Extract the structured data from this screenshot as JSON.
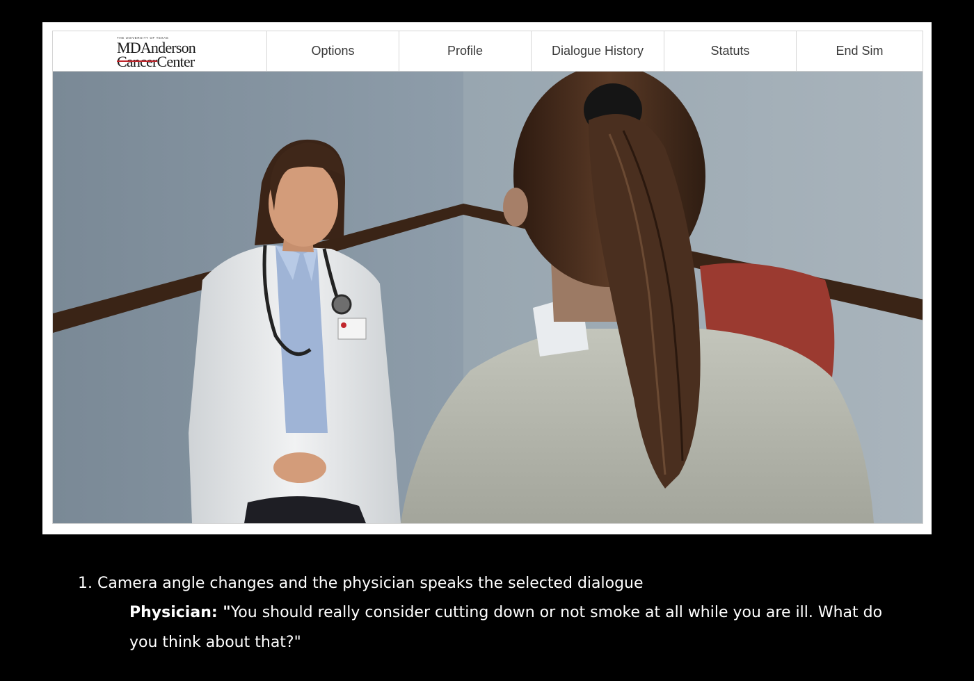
{
  "navbar": {
    "logo": {
      "small_text": "THE UNIVERSITY OF TEXAS",
      "line1": "MDAnderson",
      "line2_struck": "Cancer",
      "line2_rest": "Center"
    },
    "items": [
      {
        "label": "Options"
      },
      {
        "label": "Profile"
      },
      {
        "label": "Dialogue History"
      },
      {
        "label": "Statuts"
      },
      {
        "label": "End Sim"
      }
    ]
  },
  "scene": {
    "characters": [
      "physician",
      "patient"
    ],
    "colors": {
      "wall": "#8a98a4",
      "trim": "#3a2416",
      "coat": "#e6e8ea",
      "shirt": "#9fb4d6",
      "sweater": "#b7b9ae",
      "hair": "#4a2f1f",
      "chair": "#9b3a30"
    }
  },
  "caption": {
    "step": "1. Camera angle changes and the physician speaks the selected dialogue",
    "speaker": "Physician: \"",
    "text": "You should really consider cutting down or not smoke at all while you are ill.  What do you think about that?\""
  }
}
